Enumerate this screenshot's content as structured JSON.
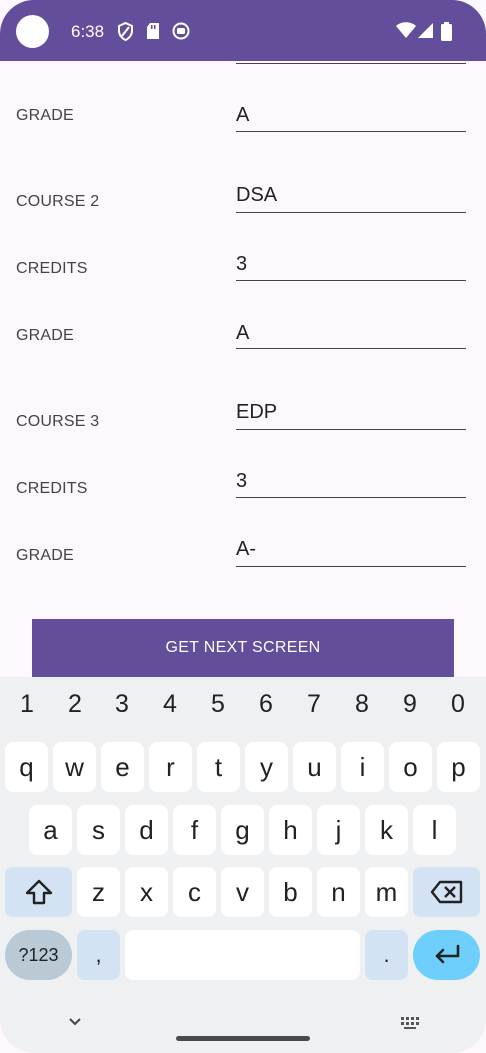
{
  "status_bar": {
    "time": "6:38",
    "icons": [
      "shield-icon",
      "sd-card-icon",
      "notification-icon",
      "wifi-icon",
      "cell-signal-icon",
      "battery-icon"
    ]
  },
  "form": {
    "grade_1": {
      "label": "GRADE",
      "value": "A"
    },
    "course_2": {
      "label": "COURSE 2",
      "value": "DSA"
    },
    "credits_2": {
      "label": "CREDITS",
      "value": "3"
    },
    "grade_2": {
      "label": "GRADE",
      "value": "A"
    },
    "course_3": {
      "label": "COURSE 3",
      "value": "EDP"
    },
    "credits_3": {
      "label": "CREDITS",
      "value": "3"
    },
    "grade_3": {
      "label": "GRADE",
      "value": "A-"
    }
  },
  "next_button": "GET NEXT SCREEN",
  "keyboard": {
    "numbers": [
      "1",
      "2",
      "3",
      "4",
      "5",
      "6",
      "7",
      "8",
      "9",
      "0"
    ],
    "row1": [
      "q",
      "w",
      "e",
      "r",
      "t",
      "y",
      "u",
      "i",
      "o",
      "p"
    ],
    "row2": [
      "a",
      "s",
      "d",
      "f",
      "g",
      "h",
      "j",
      "k",
      "l"
    ],
    "row3": [
      "z",
      "x",
      "c",
      "v",
      "b",
      "n",
      "m"
    ],
    "sym_label": "?123",
    "comma": ",",
    "period": "."
  }
}
